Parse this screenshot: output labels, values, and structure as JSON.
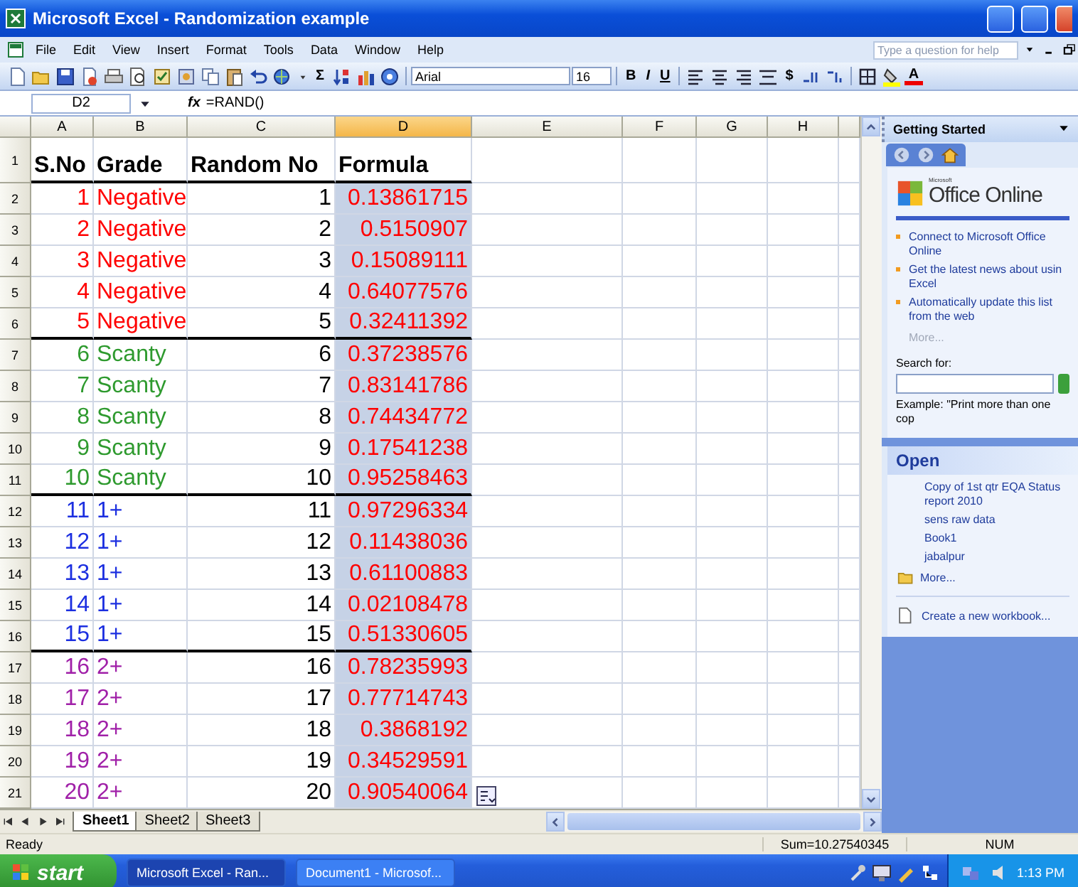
{
  "window": {
    "title": "Microsoft Excel - Randomization example"
  },
  "menu": [
    "File",
    "Edit",
    "View",
    "Insert",
    "Format",
    "Tools",
    "Data",
    "Window",
    "Help"
  ],
  "help_box": {
    "placeholder": "Type a question for help"
  },
  "toolbar": {
    "autosum": "Σ",
    "font": "Arial",
    "font_size": "16",
    "format_buttons": [
      "B",
      "I",
      "U"
    ],
    "currency": "$",
    "font_color": "A"
  },
  "formula_bar": {
    "name_box": "D2",
    "function_label": "fx",
    "formula": "=RAND()"
  },
  "columns": [
    {
      "label": "A",
      "selected": false
    },
    {
      "label": "B",
      "selected": false
    },
    {
      "label": "C",
      "selected": false
    },
    {
      "label": "D",
      "selected": true
    },
    {
      "label": "E",
      "selected": false
    },
    {
      "label": "F",
      "selected": false
    },
    {
      "label": "G",
      "selected": false
    },
    {
      "label": "H",
      "selected": false
    }
  ],
  "header_row": {
    "number": "1",
    "cells": [
      "S.No",
      "Grade",
      "Random No",
      "Formula"
    ]
  },
  "rows": [
    {
      "number": "2",
      "sno": "1",
      "grade": "Negative",
      "random_no": "1",
      "formula": "0.13861715",
      "color": "#ff0000",
      "selected": true
    },
    {
      "number": "3",
      "sno": "2",
      "grade": "Negative",
      "random_no": "2",
      "formula": "0.5150907",
      "color": "#ff0000",
      "selected": true
    },
    {
      "number": "4",
      "sno": "3",
      "grade": "Negative",
      "random_no": "3",
      "formula": "0.15089111",
      "color": "#ff0000",
      "selected": true
    },
    {
      "number": "5",
      "sno": "4",
      "grade": "Negative",
      "random_no": "4",
      "formula": "0.64077576",
      "color": "#ff0000",
      "selected": true
    },
    {
      "number": "6",
      "sno": "5",
      "grade": "Negative",
      "random_no": "5",
      "formula": "0.32411392",
      "color": "#ff0000",
      "selected": true
    },
    {
      "number": "7",
      "sno": "6",
      "grade": "Scanty",
      "random_no": "6",
      "formula": "0.37238576",
      "color": "#2e9a2e",
      "selected": true
    },
    {
      "number": "8",
      "sno": "7",
      "grade": "Scanty",
      "random_no": "7",
      "formula": "0.83141786",
      "color": "#2e9a2e",
      "selected": true
    },
    {
      "number": "9",
      "sno": "8",
      "grade": "Scanty",
      "random_no": "8",
      "formula": "0.74434772",
      "color": "#2e9a2e",
      "selected": true
    },
    {
      "number": "10",
      "sno": "9",
      "grade": "Scanty",
      "random_no": "9",
      "formula": "0.17541238",
      "color": "#2e9a2e",
      "selected": true
    },
    {
      "number": "11",
      "sno": "10",
      "grade": "Scanty",
      "random_no": "10",
      "formula": "0.95258463",
      "color": "#2e9a2e",
      "selected": true
    },
    {
      "number": "12",
      "sno": "11",
      "grade": "1+",
      "random_no": "11",
      "formula": "0.97296334",
      "color": "#1c2fe0",
      "selected": true
    },
    {
      "number": "13",
      "sno": "12",
      "grade": "1+",
      "random_no": "12",
      "formula": "0.11438036",
      "color": "#1c2fe0",
      "selected": true
    },
    {
      "number": "14",
      "sno": "13",
      "grade": "1+",
      "random_no": "13",
      "formula": "0.61100883",
      "color": "#1c2fe0",
      "selected": true
    },
    {
      "number": "15",
      "sno": "14",
      "grade": "1+",
      "random_no": "14",
      "formula": "0.02108478",
      "color": "#1c2fe0",
      "selected": true
    },
    {
      "number": "16",
      "sno": "15",
      "grade": "1+",
      "random_no": "15",
      "formula": "0.51330605",
      "color": "#1c2fe0",
      "selected": true
    },
    {
      "number": "17",
      "sno": "16",
      "grade": "2+",
      "random_no": "16",
      "formula": "0.78235993",
      "color": "#a020a8",
      "selected": true
    },
    {
      "number": "18",
      "sno": "17",
      "grade": "2+",
      "random_no": "17",
      "formula": "0.77714743",
      "color": "#a020a8",
      "selected": true
    },
    {
      "number": "19",
      "sno": "18",
      "grade": "2+",
      "random_no": "18",
      "formula": "0.3868192",
      "color": "#a020a8",
      "selected": true
    },
    {
      "number": "20",
      "sno": "19",
      "grade": "2+",
      "random_no": "19",
      "formula": "0.34529591",
      "color": "#a020a8",
      "selected": true
    },
    {
      "number": "21",
      "sno": "20",
      "grade": "2+",
      "random_no": "20",
      "formula": "0.90540064",
      "color": "#a020a8",
      "selected": true
    }
  ],
  "sheet_tabs": [
    {
      "label": "Sheet1",
      "selected": true
    },
    {
      "label": "Sheet2",
      "selected": false
    },
    {
      "label": "Sheet3",
      "selected": false
    }
  ],
  "status_bar": {
    "status": "Ready",
    "sum": "Sum=10.27540345",
    "num": "NUM"
  },
  "task_pane": {
    "title": "Getting Started",
    "logo_small": "Microsoft",
    "logo": "Office Online",
    "links": [
      {
        "lines": [
          "Connect to Microsoft Office",
          "Online"
        ]
      },
      {
        "lines": [
          "Get the latest news about usin",
          "Excel"
        ]
      },
      {
        "lines": [
          "Automatically update this list",
          "from the web"
        ]
      }
    ],
    "links_more": "More...",
    "search_label": "Search for:",
    "example": "Example:  \"Print more than one cop",
    "open_title": "Open",
    "files": [
      "Copy of 1st qtr EQA Status report 2010",
      "sens raw data",
      "Book1",
      "jabalpur"
    ],
    "files_more": "More...",
    "create": "Create a new workbook..."
  },
  "taskbar": {
    "start": "start",
    "tasks": [
      {
        "label": "Microsoft Excel - Ran...",
        "selected": true
      },
      {
        "label": "Document1 - Microsof...",
        "selected": false
      }
    ],
    "clock": "1:13 PM"
  }
}
